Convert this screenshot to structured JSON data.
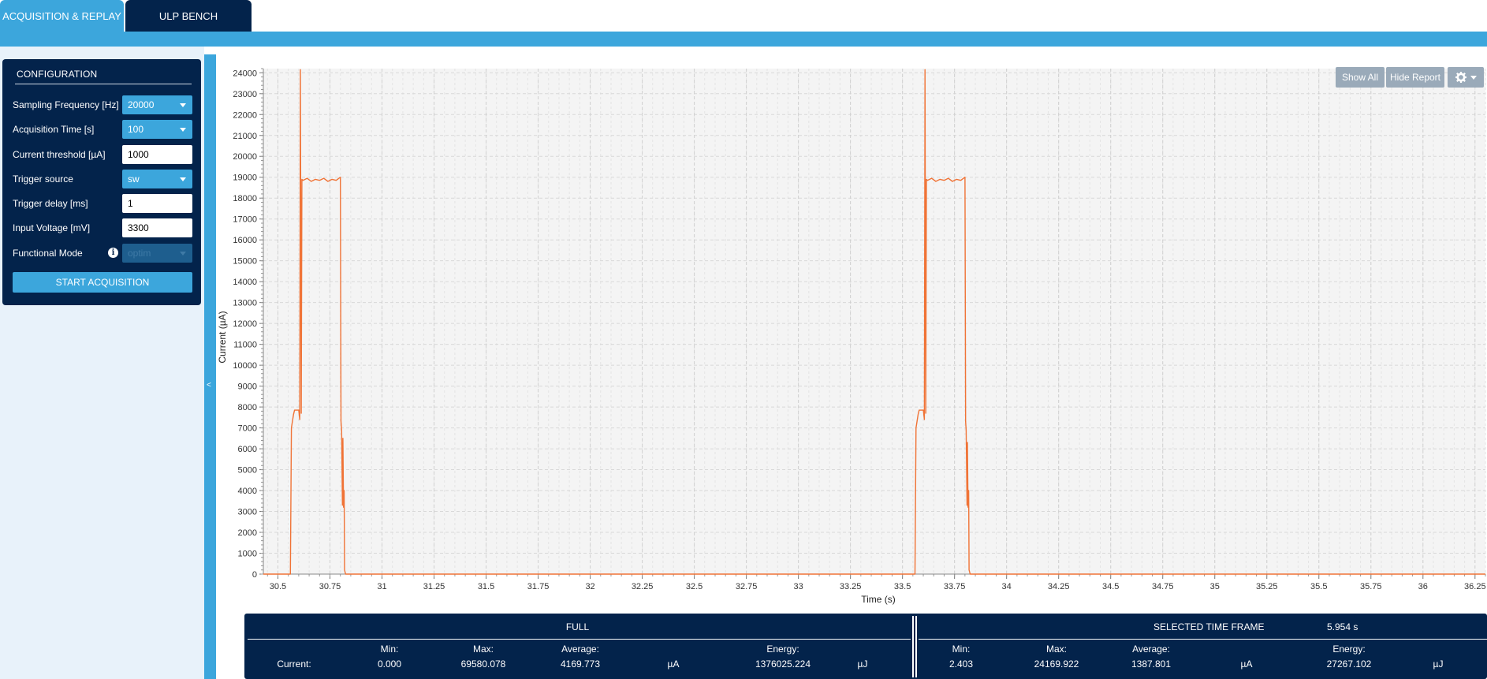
{
  "tabs": [
    {
      "label": "ACQUISITION & REPLAY",
      "active": true
    },
    {
      "label": "ULP BENCH",
      "active": false
    }
  ],
  "colors": {
    "accent": "#3ca6dc",
    "navy": "#03234b",
    "trace": "#f07336"
  },
  "config": {
    "title": "CONFIGURATION",
    "sampling_frequency": {
      "label": "Sampling Frequency [Hz]",
      "value": "20000"
    },
    "acquisition_time": {
      "label": "Acquisition Time [s]",
      "value": "100"
    },
    "current_threshold": {
      "label": "Current threshold [µA]",
      "value": "1000"
    },
    "trigger_source": {
      "label": "Trigger source",
      "value": "sw"
    },
    "trigger_delay": {
      "label": "Trigger delay [ms]",
      "value": "1"
    },
    "input_voltage": {
      "label": "Input Voltage [mV]",
      "value": "3300"
    },
    "functional_mode": {
      "label": "Functional Mode",
      "value": "optim",
      "info_icon": "info-icon"
    },
    "start_button": "START ACQUISITION"
  },
  "collapse_icon": "chevron-left-icon",
  "chart_controls": {
    "show_all": "Show All",
    "hide_report": "Hide Report",
    "settings_icon": "gear-icon"
  },
  "chart_data": {
    "type": "line",
    "xlabel": "Time (s)",
    "ylabel": "Current (µA)",
    "xlim": [
      30.43,
      36.3
    ],
    "ylim": [
      0,
      24200
    ],
    "x_ticks": [
      30.5,
      30.75,
      31,
      31.25,
      31.5,
      31.75,
      32,
      32.25,
      32.5,
      32.75,
      33,
      33.25,
      33.5,
      33.75,
      34,
      34.25,
      34.5,
      34.75,
      35,
      35.25,
      35.5,
      35.75,
      36,
      36.25
    ],
    "x_tick_labels": [
      "30.5",
      "30.75",
      "31",
      "31.25",
      "31.5",
      "31.75",
      "32",
      "32.25",
      "32.5",
      "32.75",
      "33",
      "33.25",
      "33.5",
      "33.75",
      "34",
      "34.25",
      "34.5",
      "34.75",
      "35",
      "35.25",
      "35.5",
      "35.75",
      "36",
      "36.25"
    ],
    "y_ticks": [
      0,
      1000,
      2000,
      3000,
      4000,
      5000,
      6000,
      7000,
      8000,
      9000,
      10000,
      11000,
      12000,
      13000,
      14000,
      15000,
      16000,
      17000,
      18000,
      19000,
      20000,
      21000,
      22000,
      23000,
      24000
    ],
    "y_tick_labels": [
      "0",
      "1000",
      "2000",
      "3000",
      "4000",
      "5000",
      "6000",
      "7000",
      "8000",
      "9000",
      "10000",
      "11000",
      "12000",
      "13000",
      "14000",
      "15000",
      "16000",
      "17000",
      "18000",
      "19000",
      "20000",
      "21000",
      "22000",
      "23000",
      "24000"
    ],
    "grid": true,
    "series": [
      {
        "color": "#f07336",
        "x": [
          30.43,
          30.56,
          30.565,
          30.575,
          30.58,
          30.6,
          30.605,
          30.608,
          30.612,
          30.615,
          30.62,
          30.64,
          30.66,
          30.68,
          30.7,
          30.72,
          30.74,
          30.76,
          30.78,
          30.8,
          30.803,
          30.806,
          30.81,
          30.812,
          30.815,
          30.818,
          30.82,
          30.825,
          30.83,
          33.56,
          33.565,
          33.575,
          33.58,
          33.6,
          33.605,
          33.608,
          33.612,
          33.615,
          33.62,
          33.64,
          33.66,
          33.68,
          33.7,
          33.72,
          33.74,
          33.76,
          33.78,
          33.8,
          33.803,
          33.806,
          33.81,
          33.812,
          33.815,
          33.818,
          33.82,
          33.825,
          33.83,
          36.3
        ],
        "y": [
          0,
          0,
          7000,
          7650,
          7850,
          7850,
          7400,
          24150,
          7700,
          18900,
          18850,
          18950,
          18800,
          18900,
          18850,
          18950,
          18800,
          18900,
          18850,
          19000,
          7300,
          6900,
          3300,
          6500,
          3200,
          4000,
          200,
          0,
          0,
          0,
          7000,
          7650,
          7850,
          7850,
          7400,
          24150,
          7700,
          18900,
          18850,
          18950,
          18800,
          18900,
          18850,
          18950,
          18800,
          18900,
          18850,
          19000,
          7300,
          6900,
          3300,
          6300,
          3200,
          4000,
          200,
          0,
          0,
          0
        ]
      }
    ]
  },
  "stats": {
    "full": {
      "title": "FULL",
      "row_label": "Current:",
      "min_label": "Min:",
      "min": "0.000",
      "max_label": "Max:",
      "max": "69580.078",
      "avg_label": "Average:",
      "avg": "4169.773",
      "unit_current": "µA",
      "energy_label": "Energy:",
      "energy": "1376025.224",
      "unit_energy": "µJ"
    },
    "selected": {
      "title": "SELECTED TIME FRAME",
      "duration": "5.954 s",
      "min_label": "Min:",
      "min": "2.403",
      "max_label": "Max:",
      "max": "24169.922",
      "avg_label": "Average:",
      "avg": "1387.801",
      "unit_current": "µA",
      "energy_label": "Energy:",
      "energy": "27267.102",
      "unit_energy": "µJ"
    }
  }
}
